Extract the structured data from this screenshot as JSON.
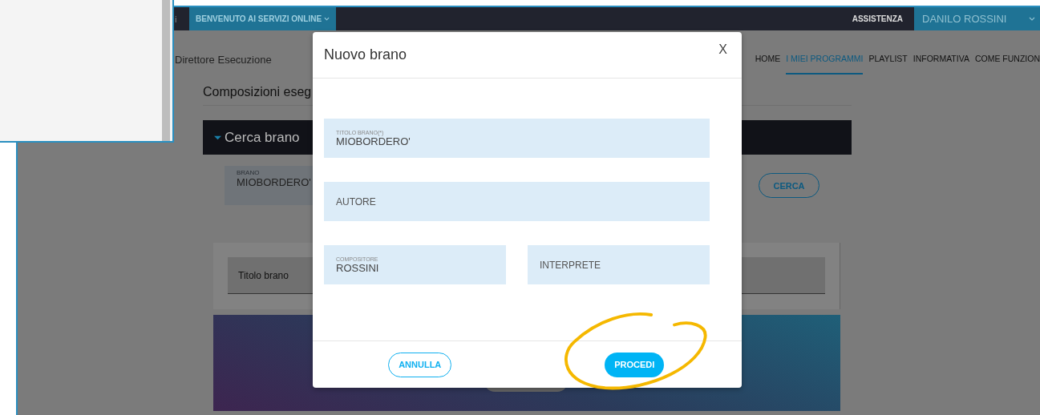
{
  "top_bar": {
    "fragment": "i",
    "welcome_menu": "BENVENUTO AI SERVIZI ONLINE",
    "help_link": "ASSISTENZA",
    "user_menu": "DANILO ROSSINI"
  },
  "header": {
    "role": "Direttore Esecuzione",
    "nav": [
      {
        "label": "HOME",
        "selected": false
      },
      {
        "label": "I MIEI PROGRAMMI",
        "selected": true
      },
      {
        "label": "PLAYLIST",
        "selected": false
      },
      {
        "label": "INFORMATIVA",
        "selected": false
      },
      {
        "label": "COME FUNZION",
        "selected": false
      }
    ]
  },
  "page": {
    "heading": "Composizioni eseg",
    "search_panel": {
      "title": "Cerca brano",
      "expanded": true,
      "field": {
        "label": "BRANO",
        "value": "MIOBORDERO'"
      },
      "button": "CERCA"
    },
    "results": {
      "columns": [
        "Titolo brano"
      ]
    }
  },
  "dialog": {
    "title": "Nuovo brano",
    "close": "X",
    "fields": [
      {
        "label": "TITOLO BRANO(*)",
        "value": "MIOBORDERO'"
      },
      {
        "placeholder": "AUTORE"
      },
      {
        "label": "COMPOSITORE",
        "value": "ROSSINI"
      },
      {
        "placeholder": "INTERPRETE"
      }
    ],
    "buttons": [
      {
        "label": "ANNULLA",
        "kind": "secondary"
      },
      {
        "label": "PROCEDI",
        "kind": "primary"
      }
    ]
  }
}
